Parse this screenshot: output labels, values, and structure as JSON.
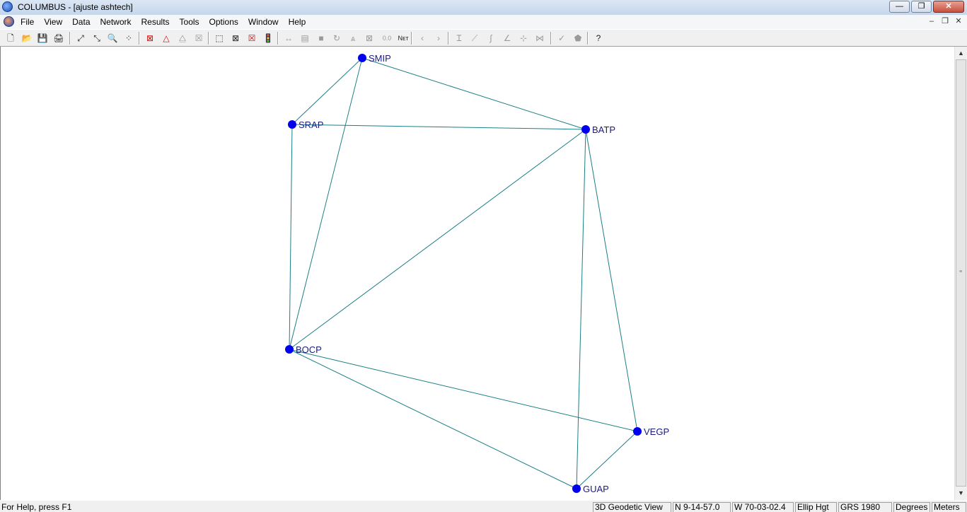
{
  "window": {
    "app_name": "COLUMBUS",
    "title": "COLUMBUS - [ajuste ashtech]",
    "minimize_label": "—",
    "restore_label": "❐",
    "close_label": "✕"
  },
  "menu": {
    "items": [
      "File",
      "View",
      "Data",
      "Network",
      "Results",
      "Tools",
      "Options",
      "Window",
      "Help"
    ],
    "mdi_minimize": "–",
    "mdi_restore": "❐",
    "mdi_close": "✕"
  },
  "toolbar": {
    "buttons": [
      {
        "name": "new-icon",
        "glyph": "🗋",
        "enabled": true
      },
      {
        "name": "open-icon",
        "glyph": "📂",
        "enabled": true
      },
      {
        "name": "save-icon",
        "glyph": "💾",
        "enabled": true
      },
      {
        "name": "print-icon",
        "glyph": "🖨",
        "enabled": true
      },
      {
        "name": "zoom-extents-icon",
        "glyph": "⤢",
        "enabled": true
      },
      {
        "name": "zoom-fit-icon",
        "glyph": "⤡",
        "enabled": true
      },
      {
        "name": "magnifier-icon",
        "glyph": "🔍",
        "enabled": true
      },
      {
        "name": "select-points-icon",
        "glyph": "⁘",
        "enabled": true
      },
      {
        "name": "delete-network-icon",
        "glyph": "⊠",
        "enabled": true,
        "color": "#cc1111"
      },
      {
        "name": "triangle-icon",
        "glyph": "△",
        "enabled": true,
        "color": "#cc1111"
      },
      {
        "name": "triangle-dotted-icon",
        "glyph": "⧋",
        "enabled": false
      },
      {
        "name": "box-x-icon",
        "glyph": "☒",
        "enabled": false
      },
      {
        "name": "select-box-icon",
        "glyph": "⬚",
        "enabled": true
      },
      {
        "name": "clear-selection-icon",
        "glyph": "⊠",
        "enabled": true
      },
      {
        "name": "delete-red-icon",
        "glyph": "☒",
        "enabled": true,
        "color": "#cc1111"
      },
      {
        "name": "traffic-light-icon",
        "glyph": "🚦",
        "enabled": true
      },
      {
        "name": "measure-horizontal-icon",
        "glyph": "↔",
        "enabled": false
      },
      {
        "name": "report-icon",
        "glyph": "▤",
        "enabled": false
      },
      {
        "name": "block-icon",
        "glyph": "■",
        "enabled": false
      },
      {
        "name": "rotate-icon",
        "glyph": "↻",
        "enabled": false
      },
      {
        "name": "tripod-icon",
        "glyph": "⩓",
        "enabled": false
      },
      {
        "name": "crossed-box-icon",
        "glyph": "⊠",
        "enabled": false
      },
      {
        "name": "precision-icon",
        "glyph": "0.0",
        "enabled": false
      },
      {
        "name": "net-icon",
        "glyph": "Nᴇᴛ",
        "enabled": true
      },
      {
        "name": "prev-icon",
        "glyph": "‹",
        "enabled": false
      },
      {
        "name": "next-icon",
        "glyph": "›",
        "enabled": false
      },
      {
        "name": "vertical-bar-icon",
        "glyph": "Ɪ",
        "enabled": false
      },
      {
        "name": "slope-icon",
        "glyph": "⟋",
        "enabled": false
      },
      {
        "name": "curve-icon",
        "glyph": "∫",
        "enabled": false
      },
      {
        "name": "angle-icon",
        "glyph": "∠",
        "enabled": false
      },
      {
        "name": "axes-icon",
        "glyph": "⊹",
        "enabled": false
      },
      {
        "name": "azimuth-icon",
        "glyph": "⋈",
        "enabled": false
      },
      {
        "name": "check-icon",
        "glyph": "✓",
        "enabled": false
      },
      {
        "name": "shape-icon",
        "glyph": "⬟",
        "enabled": false
      },
      {
        "name": "context-help-icon",
        "glyph": "?",
        "enabled": true
      }
    ]
  },
  "network": {
    "stations": [
      {
        "id": "SMIP"
      },
      {
        "id": "SRAP"
      },
      {
        "id": "BATP"
      },
      {
        "id": "BOCP"
      },
      {
        "id": "VEGP"
      },
      {
        "id": "GUAP"
      }
    ],
    "edges": [
      [
        "SMIP",
        "SRAP"
      ],
      [
        "SMIP",
        "BATP"
      ],
      [
        "SMIP",
        "BOCP"
      ],
      [
        "SRAP",
        "BATP"
      ],
      [
        "SRAP",
        "BOCP"
      ],
      [
        "BATP",
        "BOCP"
      ],
      [
        "BATP",
        "VEGP"
      ],
      [
        "BATP",
        "GUAP"
      ],
      [
        "BOCP",
        "VEGP"
      ],
      [
        "BOCP",
        "GUAP"
      ],
      [
        "VEGP",
        "GUAP"
      ]
    ],
    "colors": {
      "node": "#0000ee",
      "edge": "#1a7f86",
      "label": "#1a1a80",
      "background": "#ffffff"
    }
  },
  "statusbar": {
    "help": "For Help, press F1",
    "view": "3D Geodetic View",
    "north": "N   9-14-57.0",
    "west": "W   70-03-02.4",
    "height_type": "Ellip Hgt",
    "datum": "GRS 1980",
    "angle_units": "Degrees",
    "length_units": "Meters"
  }
}
